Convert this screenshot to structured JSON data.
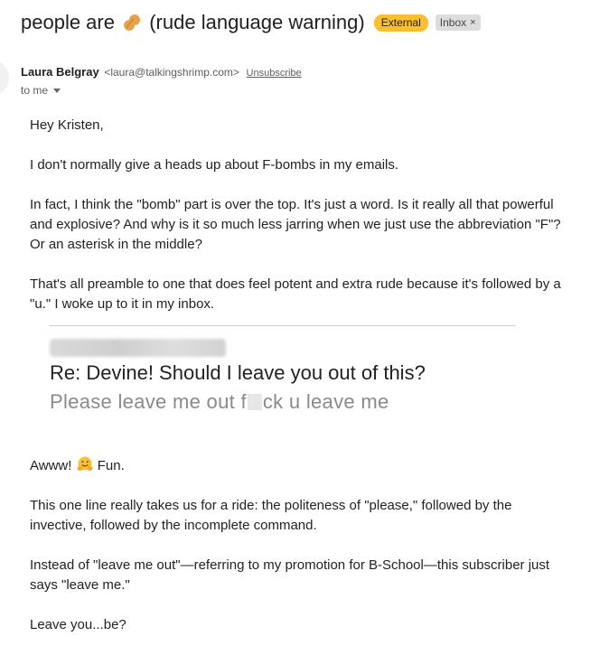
{
  "subject": {
    "text_before": "people are",
    "text_after": "(rude language warning)",
    "emoji": "peanut"
  },
  "labels": {
    "external": "External",
    "inbox": "Inbox",
    "inbox_close": "×"
  },
  "sender": {
    "name": "Laura Belgray",
    "email": "<laura@talkingshrimp.com>",
    "unsubscribe": "Unsubscribe"
  },
  "recipient": {
    "to": "to me"
  },
  "body": {
    "greeting": "Hey Kristen,",
    "p1": "I don't normally give a heads up about F-bombs in my emails.",
    "p2": "In fact, I think the \"bomb\" part is over the top. It's just a word. Is it really all that powerful and explosive? And why is it so much less jarring when we just use the abbreviation \"F\"? Or an asterisk in the middle?",
    "p3": "That's all preamble to one that does feel potent and extra rude because it's followed by a \"u.\" I woke up to it in my inbox.",
    "quote": {
      "subject": "Re: Devine! Should I leave you out of this?",
      "preview_before": "Please leave me out f",
      "preview_after": "ck u leave me"
    },
    "p4_before": "Awww!",
    "p4_after": "Fun.",
    "p5": "This one line really takes us for a ride: the politeness of \"please,\" followed by the invective, followed by the incomplete command.",
    "p6": "Instead of \"leave me out\"—referring to my promotion for B-School—this subscriber just says \"leave me.\"",
    "p7": "Leave you...be?"
  },
  "colors": {
    "external_badge": "#f9bf2c",
    "inbox_badge": "#dddddd"
  },
  "icons": [
    "peanut-icon",
    "close-icon",
    "caret-down-icon",
    "hugging-face-icon"
  ]
}
